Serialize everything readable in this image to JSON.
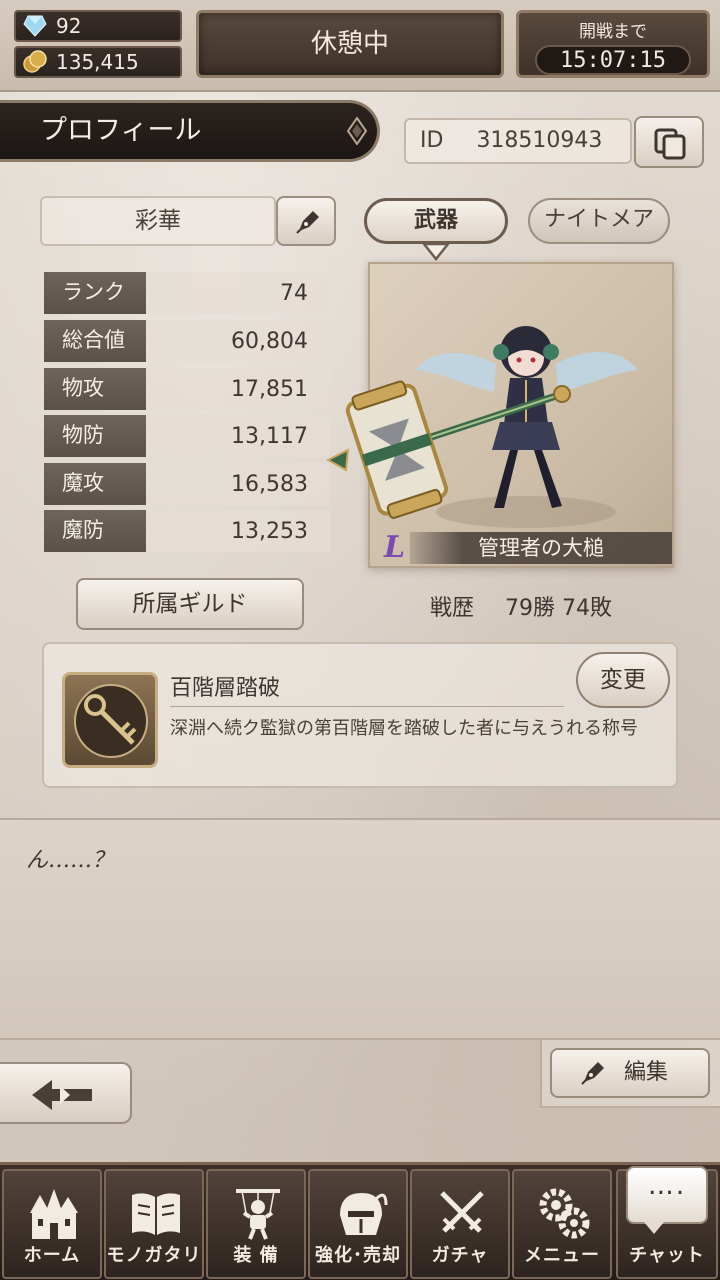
{
  "resources": {
    "gems": "92",
    "coins": "135,415"
  },
  "status": {
    "label": "休憩中"
  },
  "battle_timer": {
    "label": "開戦まで",
    "value": "15:07:15"
  },
  "profile": {
    "tab_title": "プロフィール",
    "id_label": "ID",
    "id_value": "318510943"
  },
  "player": {
    "name": "彩華"
  },
  "stats": [
    {
      "label": "ランク",
      "value": "74"
    },
    {
      "label": "総合値",
      "value": "60,804"
    },
    {
      "label": "物攻",
      "value": "17,851"
    },
    {
      "label": "物防",
      "value": "13,117"
    },
    {
      "label": "魔攻",
      "value": "16,583"
    },
    {
      "label": "魔防",
      "value": "13,253"
    }
  ],
  "tabs": {
    "weapon": "武器",
    "nightmare": "ナイトメア"
  },
  "weapon": {
    "name": "管理者の大槌",
    "rarity": "L"
  },
  "guild": {
    "button_label": "所属ギルド"
  },
  "record": {
    "label": "戦歴",
    "value": "79勝 74敗"
  },
  "title_card": {
    "name": "百階層踏破",
    "description": "深淵へ続ク監獄の第百階層を踏破した者に与えうれる称号",
    "change_label": "変更"
  },
  "comment": {
    "text": "ん……？"
  },
  "edit": {
    "label": "編集"
  },
  "nav": [
    {
      "label": "ホーム",
      "icon": "castle-icon"
    },
    {
      "label": "モノガタリ",
      "icon": "book-icon"
    },
    {
      "label": "装 備",
      "icon": "puppet-icon"
    },
    {
      "label": "強化･売却",
      "icon": "helmet-icon"
    },
    {
      "label": "ガチャ",
      "icon": "crossed-swords-icon"
    },
    {
      "label": "メニュー",
      "icon": "gears-icon"
    },
    {
      "label": "チャット",
      "icon": "chat-bubble-icon"
    }
  ],
  "chat": {
    "bubble": "…."
  }
}
